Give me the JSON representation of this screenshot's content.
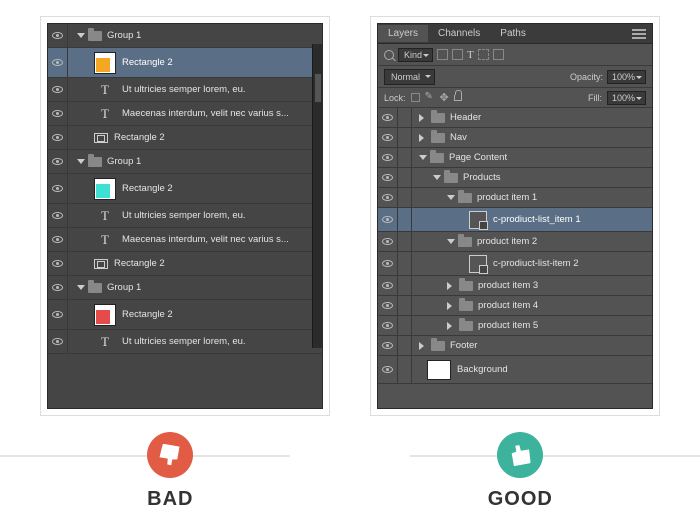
{
  "bad_panel": {
    "groups": [
      {
        "name": "Group 1",
        "expanded": true,
        "items": [
          {
            "type": "shape-orange",
            "label": "Rectangle 2",
            "selected": true
          },
          {
            "type": "text",
            "label": "Ut ultricies semper lorem, eu."
          },
          {
            "type": "text",
            "label": "Maecenas interdum, velit nec varius s..."
          },
          {
            "type": "rect",
            "label": "Rectangle 2"
          }
        ]
      },
      {
        "name": "Group 1",
        "expanded": true,
        "items": [
          {
            "type": "shape-cyan",
            "label": "Rectangle 2"
          },
          {
            "type": "text",
            "label": "Ut ultricies semper lorem, eu."
          },
          {
            "type": "text",
            "label": "Maecenas interdum, velit nec varius s..."
          },
          {
            "type": "rect",
            "label": "Rectangle 2"
          }
        ]
      },
      {
        "name": "Group 1",
        "expanded": true,
        "items": [
          {
            "type": "shape-red",
            "label": "Rectangle 2"
          },
          {
            "type": "text",
            "label": "Ut ultricies semper lorem, eu."
          }
        ]
      }
    ]
  },
  "good_panel": {
    "tabs": {
      "layers": "Layers",
      "channels": "Channels",
      "paths": "Paths"
    },
    "kind": "Kind",
    "blend": "Normal",
    "opacity_lbl": "Opacity:",
    "opacity_val": "100%",
    "lock_lbl": "Lock:",
    "fill_lbl": "Fill:",
    "fill_val": "100%",
    "tree": [
      {
        "d": 0,
        "disc": "right",
        "icon": "folder",
        "label": "Header"
      },
      {
        "d": 0,
        "disc": "right",
        "icon": "folder",
        "label": "Nav"
      },
      {
        "d": 0,
        "disc": "down",
        "icon": "folder",
        "label": "Page Content"
      },
      {
        "d": 1,
        "disc": "down",
        "icon": "folder",
        "label": "Products"
      },
      {
        "d": 2,
        "disc": "down",
        "icon": "folder",
        "label": "product item 1"
      },
      {
        "d": 3,
        "disc": "",
        "icon": "smart",
        "label": "c-prodiuct-list_item 1",
        "selected": true
      },
      {
        "d": 2,
        "disc": "down",
        "icon": "folder",
        "label": "product item 2"
      },
      {
        "d": 3,
        "disc": "",
        "icon": "smart",
        "label": "c-prodiuct-list-item 2"
      },
      {
        "d": 2,
        "disc": "right",
        "icon": "folder",
        "label": "product item 3"
      },
      {
        "d": 2,
        "disc": "right",
        "icon": "folder",
        "label": "product item 4"
      },
      {
        "d": 2,
        "disc": "right",
        "icon": "folder",
        "label": "product item 5"
      },
      {
        "d": 0,
        "disc": "right",
        "icon": "folder",
        "label": "Footer"
      },
      {
        "d": 0,
        "disc": "",
        "icon": "bg",
        "label": "Background"
      }
    ]
  },
  "labels": {
    "bad": "BAD",
    "good": "GOOD"
  }
}
